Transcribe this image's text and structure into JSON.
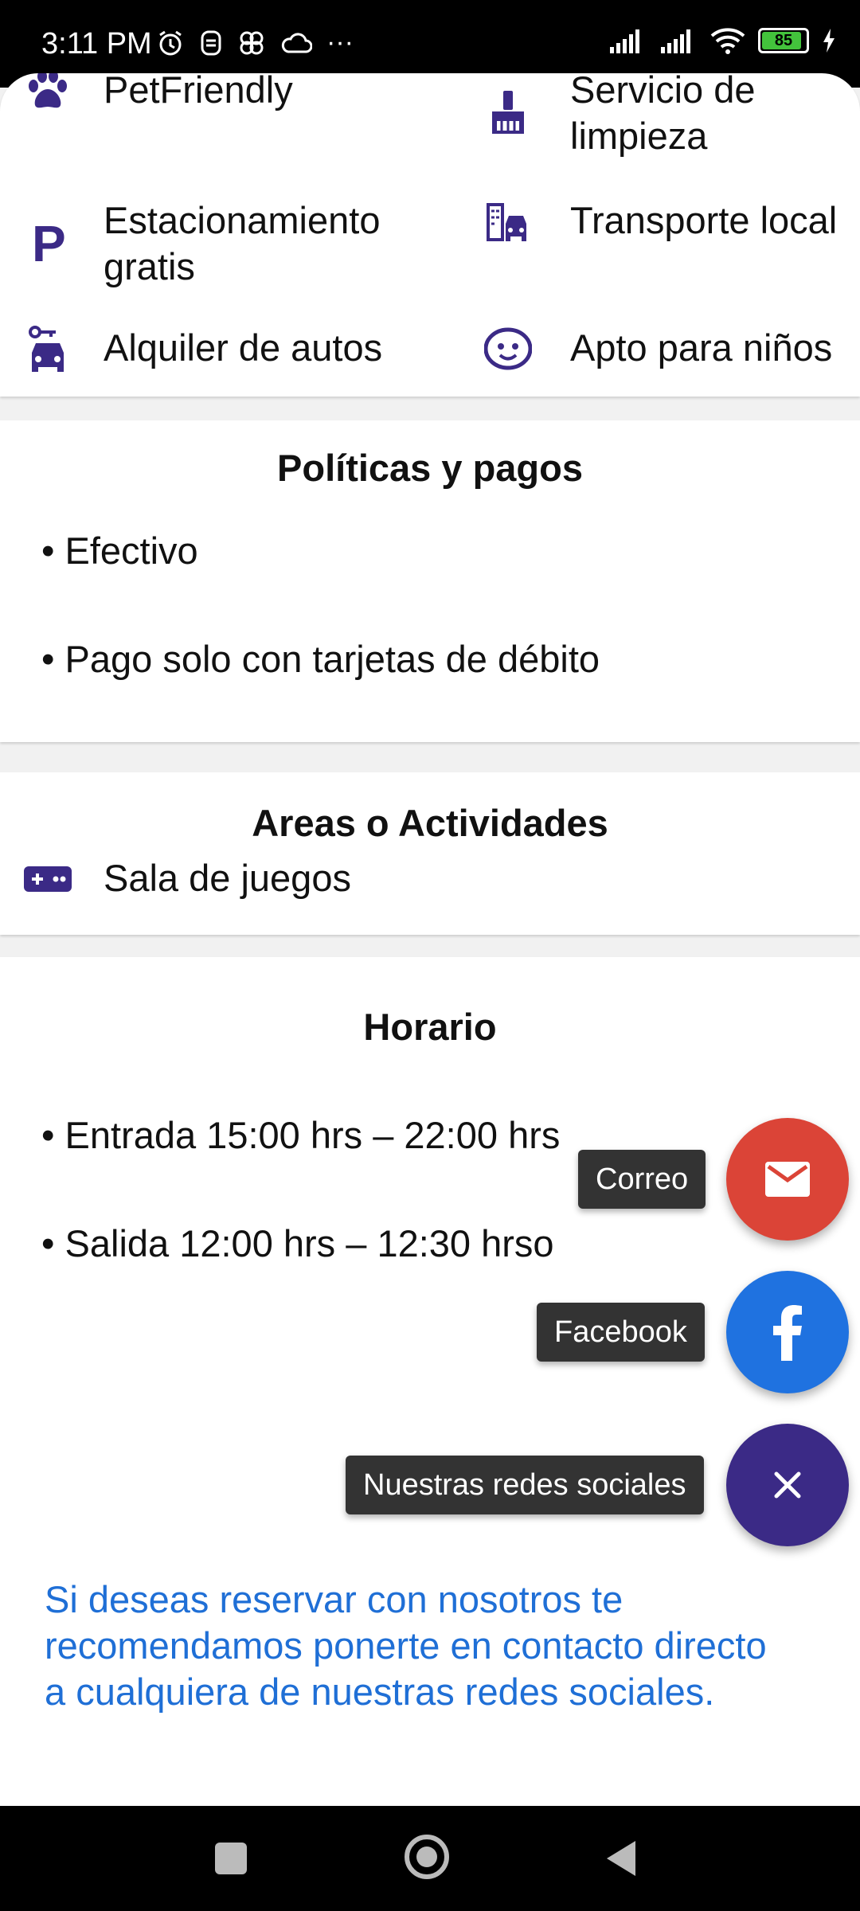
{
  "status_bar": {
    "time": "3:11 PM",
    "more": "···",
    "battery": "85"
  },
  "amenities": [
    {
      "label": "PetFriendly",
      "icon": "paw-icon"
    },
    {
      "label": "Servicio de limpieza",
      "icon": "cleaning-brush-icon"
    },
    {
      "label": "Estacionamiento gratis",
      "icon": "parking-icon"
    },
    {
      "label": "Transporte local",
      "icon": "local-transport-icon"
    },
    {
      "label": "Alquiler de autos",
      "icon": "car-rental-icon"
    },
    {
      "label": "Apto para niños",
      "icon": "child-friendly-icon"
    }
  ],
  "policies": {
    "title": "Políticas y pagos",
    "items": [
      "• Efectivo",
      "• Pago solo con tarjetas de débito"
    ]
  },
  "activities": {
    "title": "Areas o Actividades",
    "items": [
      {
        "label": "Sala de juegos",
        "icon": "gamepad-icon"
      }
    ]
  },
  "schedule": {
    "title": "Horario",
    "items": [
      "• Entrada 15:00 hrs – 22:00 hrs",
      "• Salida 12:00 hrs – 12:30 hrso"
    ]
  },
  "fab_menu": {
    "email_label": "Correo",
    "facebook_label": "Facebook",
    "main_label": "Nuestras redes sociales",
    "email_color": "#db4437",
    "facebook_color": "#1f72e0",
    "main_color": "#3b2a86"
  },
  "contact": {
    "text": "Si deseas reservar con nosotros te recomendamos ponerte en contacto directo a cualquiera de nuestras redes sociales."
  },
  "colors": {
    "accent": "#3b2a86",
    "link": "#1f6fd6"
  }
}
